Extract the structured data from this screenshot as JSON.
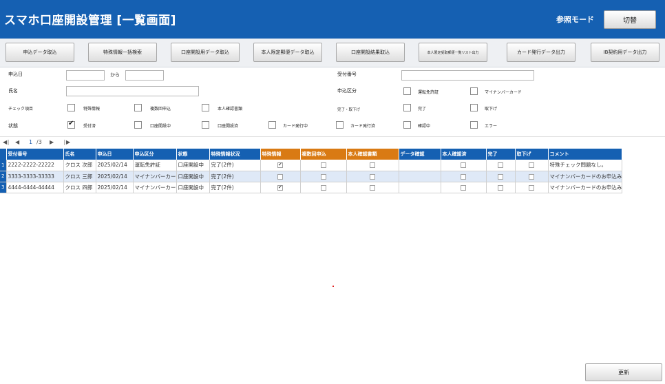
{
  "header": {
    "title": "スマホ口座開設管理 [一覧画面]",
    "mode_label": "参照モード",
    "switch_label": "切替",
    "background_color": "#1560b2"
  },
  "toolbar": {
    "buttons": [
      "申込データ取込",
      "特殊情報一括検索",
      "口座開設用データ取込",
      "本人限定郵便データ取込",
      "口座開設結果取込",
      "本人限定受取郵便一覧リスト出力",
      "カード発行データ出力",
      "IB契約用データ出力"
    ]
  },
  "filters": {
    "application_date_label": "申込日",
    "from_label": "から",
    "application_date_from": "",
    "application_date_to": "",
    "name_label": "氏名",
    "name_value": "",
    "receipt_no_label": "受付番号",
    "receipt_no_value": "",
    "application_type_label": "申込区分",
    "application_types": [
      {
        "label": "運転免許証",
        "checked": false
      },
      {
        "label": "マイナンバーカード",
        "checked": false
      }
    ],
    "check_items_label": "チェック項目",
    "check_items": [
      {
        "label": "特殊情報",
        "checked": false
      },
      {
        "label": "複数回申込",
        "checked": false
      },
      {
        "label": "本人確認書類",
        "checked": false
      }
    ],
    "completion_label": "完了・取下げ",
    "completion_items": [
      {
        "label": "完了",
        "checked": false
      },
      {
        "label": "取下げ",
        "checked": false
      }
    ],
    "status_label": "状態",
    "status_items": [
      {
        "label": "受付済",
        "checked": true
      },
      {
        "label": "口座開設中",
        "checked": false
      },
      {
        "label": "口座開設済",
        "checked": false
      },
      {
        "label": "カード発行中",
        "checked": false
      },
      {
        "label": "カード発行済",
        "checked": false
      },
      {
        "label": "確認中",
        "checked": false
      },
      {
        "label": "エラー",
        "checked": false
      }
    ]
  },
  "pager": {
    "first_icon": "first-page-icon",
    "prev_icon": "prev-page-icon",
    "current_page": "1",
    "total_pages": "/3",
    "next_icon": "next-page-icon",
    "last_icon": "last-page-icon"
  },
  "grid": {
    "header_color": "#1560b2",
    "highlight_header_color": "#d97a13",
    "alt_row_color": "#dfe9f7",
    "columns": [
      {
        "label": "受付番号",
        "highlight": false
      },
      {
        "label": "氏名",
        "highlight": false
      },
      {
        "label": "申込日",
        "highlight": false
      },
      {
        "label": "申込区分",
        "highlight": false
      },
      {
        "label": "状態",
        "highlight": false
      },
      {
        "label": "特殊情報状況",
        "highlight": false
      },
      {
        "label": "特殊情報",
        "highlight": true
      },
      {
        "label": "複数回申込",
        "highlight": true
      },
      {
        "label": "本人確認書類",
        "highlight": true
      },
      {
        "label": "データ確認",
        "highlight": false
      },
      {
        "label": "本人確認済",
        "highlight": false
      },
      {
        "label": "完了",
        "highlight": false
      },
      {
        "label": "取下げ",
        "highlight": false
      },
      {
        "label": "コメント",
        "highlight": false
      }
    ],
    "rows": [
      {
        "no": "1",
        "receipt_no": "2222-2222-22222",
        "name": "クロス 次郎",
        "date": "2025/02/14",
        "type": "運転免許証",
        "status": "口座開設中",
        "special_status": "完了(2件)",
        "special_info": true,
        "multiple": false,
        "id_docs": false,
        "identity_confirmed": false,
        "completed": false,
        "withdrawn": false,
        "comment": "特殊チェック問題なし。"
      },
      {
        "no": "2",
        "receipt_no": "3333-3333-33333",
        "name": "クロス 三郎",
        "date": "2025/02/14",
        "type": "マイナンバーカード",
        "status": "口座開設中",
        "special_status": "完了(2件)",
        "special_info": false,
        "multiple": false,
        "id_docs": false,
        "identity_confirmed": false,
        "completed": false,
        "withdrawn": false,
        "comment": "マイナンバーカードのお申込み。"
      },
      {
        "no": "3",
        "receipt_no": "4444-4444-44444",
        "name": "クロス 四郎",
        "date": "2025/02/14",
        "type": "マイナンバーカード",
        "status": "口座開設中",
        "special_status": "完了(2件)",
        "special_info": true,
        "multiple": false,
        "id_docs": false,
        "identity_confirmed": false,
        "completed": false,
        "withdrawn": false,
        "comment": "マイナンバーカードのお申込み。"
      }
    ]
  },
  "footer": {
    "update_label": "更新"
  }
}
